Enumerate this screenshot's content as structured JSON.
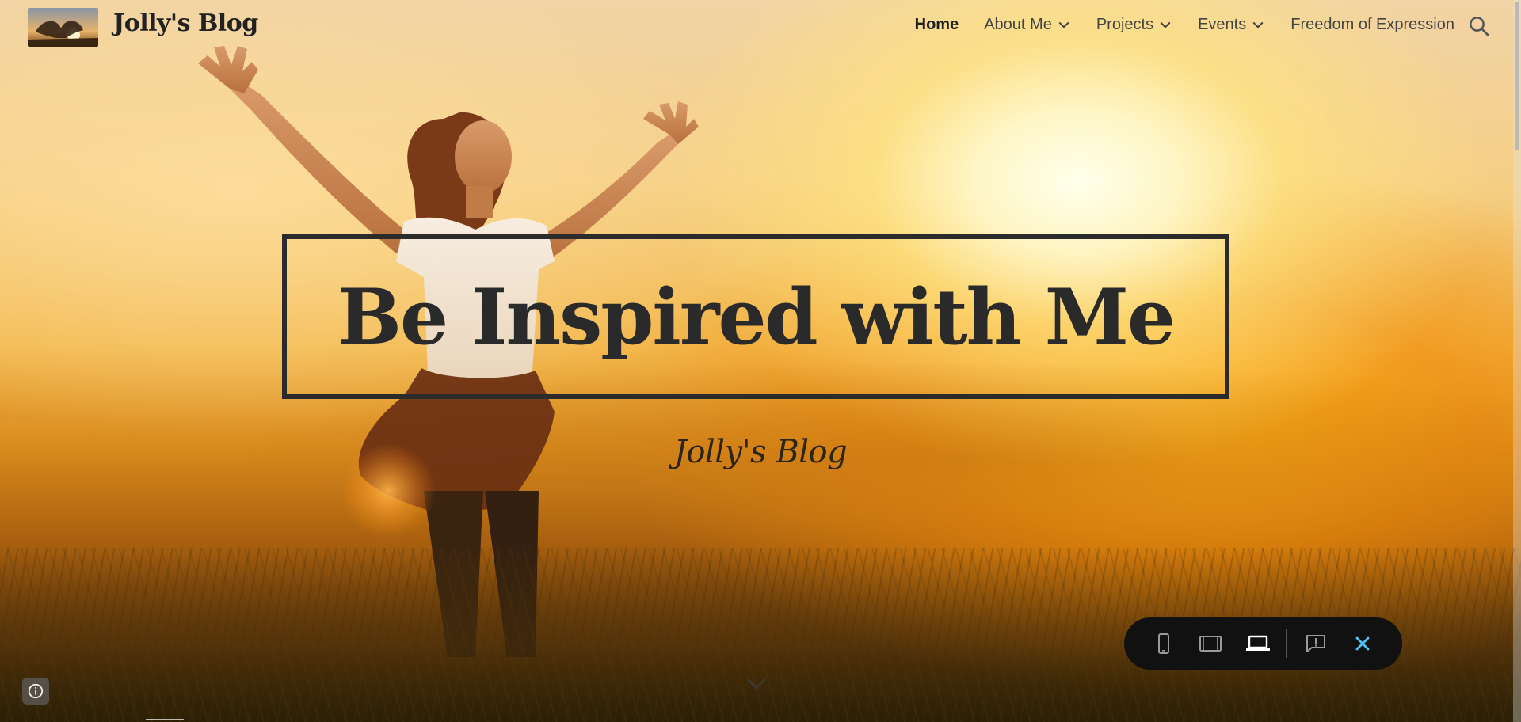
{
  "site": {
    "title": "Jolly's Blog"
  },
  "nav": {
    "items": [
      {
        "label": "Home",
        "active": true,
        "has_dropdown": false
      },
      {
        "label": "About Me",
        "active": false,
        "has_dropdown": true
      },
      {
        "label": "Projects",
        "active": false,
        "has_dropdown": true
      },
      {
        "label": "Events",
        "active": false,
        "has_dropdown": true
      },
      {
        "label": "Freedom of Expression",
        "active": false,
        "has_dropdown": false
      }
    ],
    "search_icon": "search-icon"
  },
  "hero": {
    "title": "Be Inspired with Me",
    "subtitle": "Jolly's Blog",
    "scroll_icon": "chevron-down-icon"
  },
  "preview_toolbar": {
    "buttons": [
      {
        "name": "phone-preview-icon",
        "active": false
      },
      {
        "name": "tablet-preview-icon",
        "active": false
      },
      {
        "name": "laptop-preview-icon",
        "active": true
      },
      {
        "name": "report-abuse-icon",
        "active": false
      },
      {
        "name": "close-icon",
        "active": false
      }
    ],
    "accent_color": "#4fc3f7"
  },
  "info_button": {
    "icon": "info-icon"
  },
  "colors": {
    "title_text": "#2a2a2a",
    "nav_text": "#444444",
    "toolbar_bg": "#111111"
  }
}
